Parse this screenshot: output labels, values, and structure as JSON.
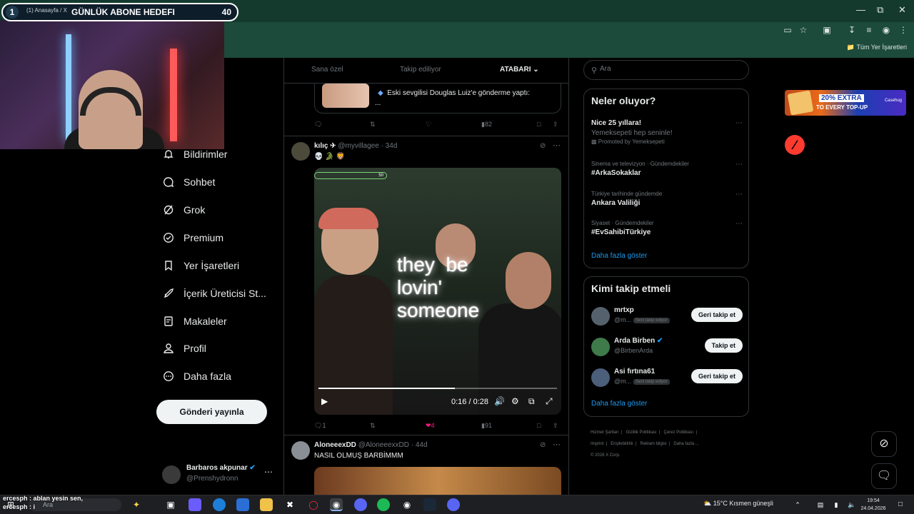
{
  "stream_overlay": {
    "goal_index": "1",
    "goal_title": "GÜNLÜK ABONE HEDEFI",
    "goal_count": "40",
    "tab_ghost": "(1) Anasayfa / X"
  },
  "browser": {
    "bookmarks_all": "Tüm Yer İşaretleri"
  },
  "nav": {
    "items": [
      {
        "label": "Bildirimler",
        "icon": "bell-icon"
      },
      {
        "label": "Sohbet",
        "icon": "chat-icon"
      },
      {
        "label": "Grok",
        "icon": "grok-icon"
      },
      {
        "label": "Premium",
        "icon": "premium-icon"
      },
      {
        "label": "Yer İşaretleri",
        "icon": "bookmark-icon"
      },
      {
        "label": "İçerik Üreticisi St...",
        "icon": "rocket-icon"
      },
      {
        "label": "Makaleler",
        "icon": "article-icon"
      },
      {
        "label": "Profil",
        "icon": "profile-icon"
      },
      {
        "label": "Daha fazla",
        "icon": "more-circle-icon"
      }
    ],
    "post_button": "Gönderi yayınla",
    "account_name": "Barbaros akpunar",
    "account_handle": "@Prenshydronn"
  },
  "feed": {
    "tabs": [
      "Sana özel",
      "Takip ediliyor",
      "ATABARI"
    ],
    "quote_text": "Eski sevgilisi Douglas Luiz'e gönderme yaptı:",
    "quote_more": "...",
    "first_actions": {
      "views": "82"
    },
    "post1": {
      "name": "kılıç ✈",
      "handle": "@myvillagee",
      "age": "· 34d",
      "body": "💀 🐊 🦁",
      "caption": "they  be\nlovin'\nsomeone",
      "mini_goal_count": "50",
      "progress": 0.571,
      "time": "0:16 / 0:28",
      "replies": "1",
      "likes": "4",
      "views": "91"
    },
    "post2": {
      "name": "AloneeexDD",
      "handle": "@AloneeexxDD",
      "age": "· 44d",
      "body": "NASIL OLMUŞ BARBİMMM"
    }
  },
  "right": {
    "search_placeholder": "Ara",
    "trends_title": "Neler oluyor?",
    "promo": {
      "title": "Nice 25 yıllara!",
      "sub": "Yemeksepeti hep seninle!",
      "promoted": "Promoted by Yemeksepeti"
    },
    "trends": [
      {
        "category": "Sinema ve televizyon · Gündemdekiler",
        "title": "#ArkaSokaklar"
      },
      {
        "category": "Türkiye tarihinde gündemde",
        "title": "Ankara Valiliği"
      },
      {
        "category": "Siyaset · Gündemdekiler",
        "title": "#EvSahibiTürkiye"
      }
    ],
    "show_more": "Daha fazla göster",
    "who_title": "Kimi takip etmeli",
    "who": [
      {
        "name": "mrtxp",
        "handle": "@m...",
        "badge": "Seni takip ediyor",
        "button": "Geri takip et"
      },
      {
        "name": "Arda Birben",
        "handle": "@BirbenArda",
        "badge": "",
        "button": "Takip et"
      },
      {
        "name": "Asi fırtına61",
        "handle": "@m...",
        "badge": "Seni takip ediyor",
        "button": "Geri takip et"
      }
    ],
    "who_show_more": "Daha fazla göster",
    "footer": [
      "Hizmet Şartları",
      "Gizlilik Politikası",
      "Çerez Politikası",
      "Imprint",
      "Erişilebilirlik",
      "Reklam bilgisi",
      "Daha fazla ...",
      "© 2026 X Corp."
    ]
  },
  "ad": {
    "line1": "20% EXTRA",
    "line2": "TO EVERY TOP-UP",
    "brand": "Casehug"
  },
  "chat": [
    "ercesph : ablan yesin sen,",
    "ercesph : i"
  ],
  "taskbar": {
    "search": "Ara",
    "weather": "15°C  Kısmen güneşli",
    "time": "19:54",
    "date": "24.04.2026"
  }
}
